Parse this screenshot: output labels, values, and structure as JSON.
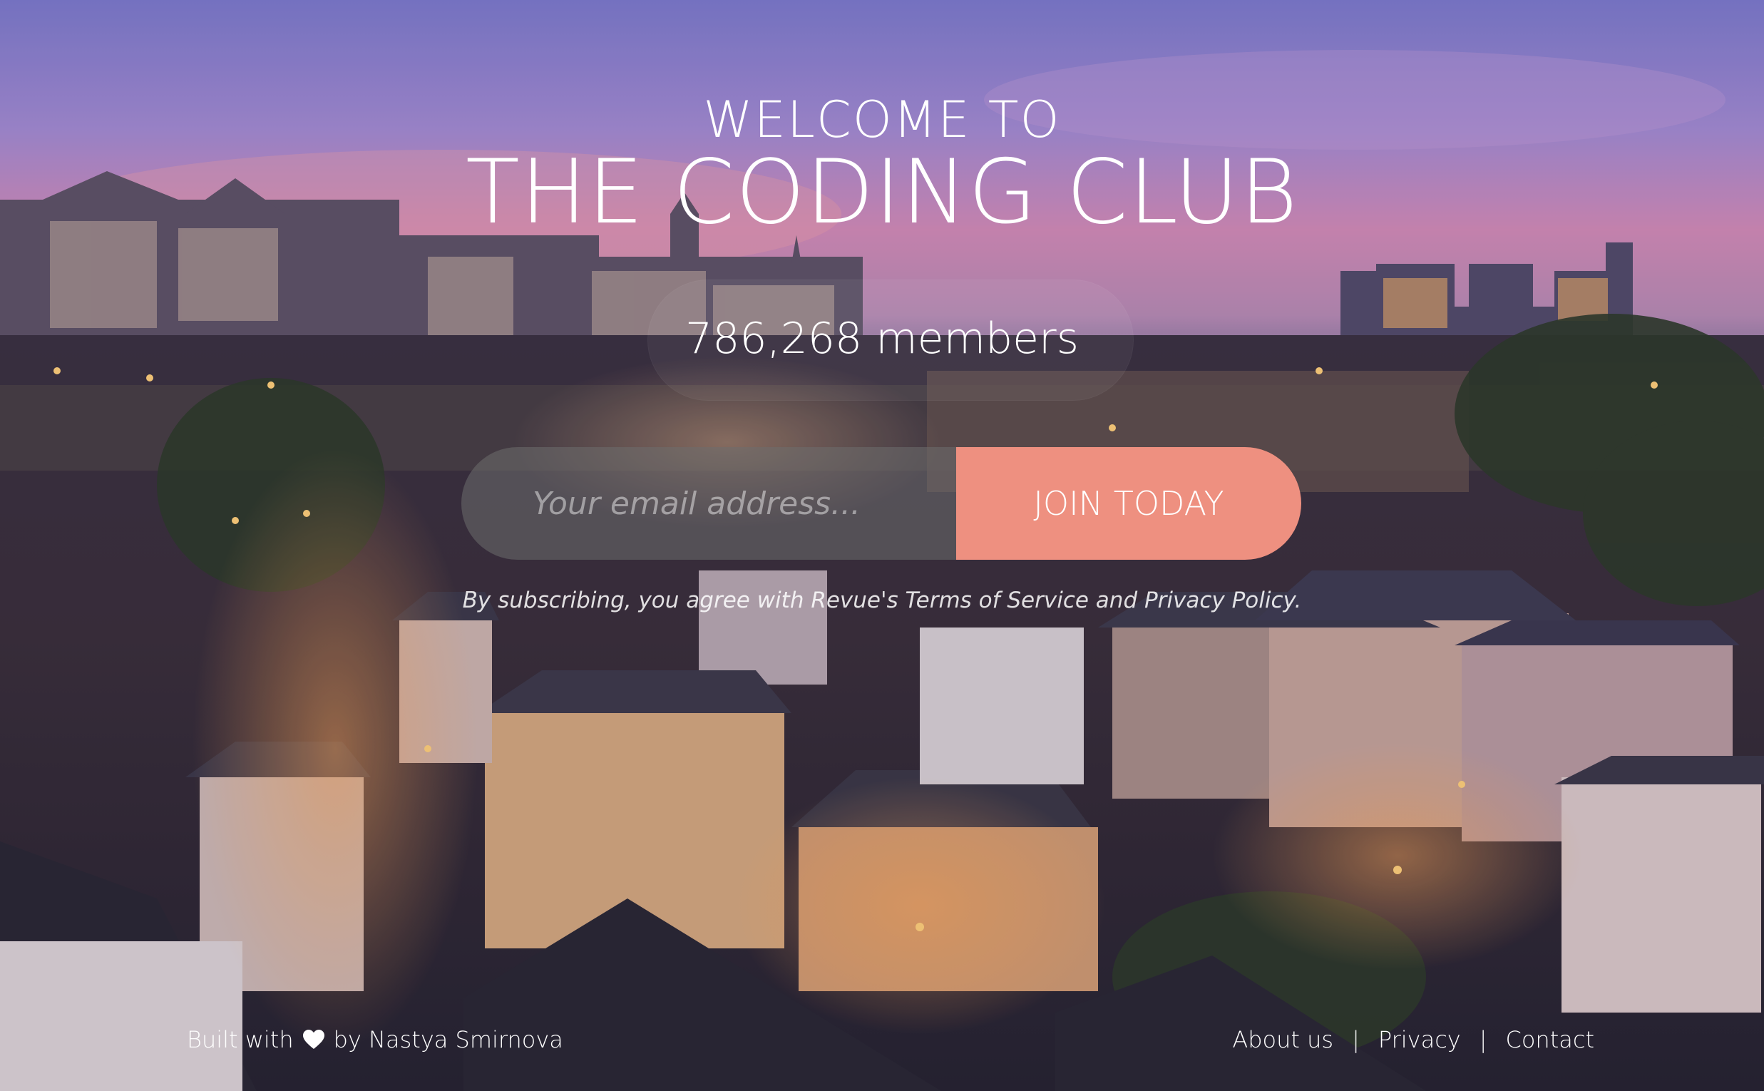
{
  "hero": {
    "welcome": "WELCOME TO",
    "title": "THE CODING CLUB",
    "members": "786,268 members"
  },
  "signup": {
    "email_placeholder": "Your email address...",
    "join_label": "JOIN TODAY",
    "terms": "By subscribing, you agree with Revue's Terms of Service and Privacy Policy."
  },
  "footer": {
    "credit_prefix": "Built with",
    "credit_suffix": "by Nastya Smirnova",
    "links": [
      "About us",
      "Privacy",
      "Contact"
    ],
    "separator": "|"
  },
  "colors": {
    "accent": "#ee9080",
    "input_bg": "#6e6e6e",
    "text": "#ffffff",
    "sky_top": "#7a76c8",
    "sky_horizon": "#e08aa0",
    "night_city": "#2b2838"
  },
  "icons": {
    "heart": "heart-icon"
  },
  "background": {
    "subject": "Luxembourg old town at dusk"
  }
}
